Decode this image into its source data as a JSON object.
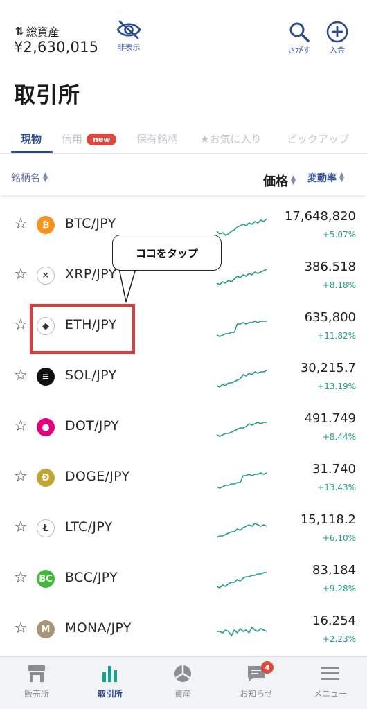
{
  "header": {
    "asset_icon": "swap-arrows-icon",
    "asset_label": "総資産",
    "asset_value": "¥2,630,015",
    "hide_label": "非表示",
    "search_label": "さがす",
    "deposit_label": "入金"
  },
  "page_title": "取引所",
  "tabs": [
    {
      "label": "現物",
      "active": true
    },
    {
      "label": "信用",
      "badge": "new"
    },
    {
      "label": "保有銘柄"
    },
    {
      "label": "★お気に入り"
    },
    {
      "label": "ピックアップ"
    }
  ],
  "sort": {
    "name": "銘柄名",
    "price": "価格",
    "change": "変動率"
  },
  "callout_text": "ココをタップ",
  "rows": [
    {
      "pair": "BTC/JPY",
      "price": "17,648,820",
      "change": "+5.07%",
      "color": "#f7931a",
      "glyph": "₿"
    },
    {
      "pair": "XRP/JPY",
      "price": "386.518",
      "change": "+8.18%",
      "color": "#ffffff",
      "glyph": "✕"
    },
    {
      "pair": "ETH/JPY",
      "price": "635,800",
      "change": "+11.82%",
      "color": "#ffffff",
      "glyph": "◆"
    },
    {
      "pair": "SOL/JPY",
      "price": "30,215.7",
      "change": "+13.19%",
      "color": "#111111",
      "glyph": "≡"
    },
    {
      "pair": "DOT/JPY",
      "price": "491.749",
      "change": "+8.44%",
      "color": "#e6007a",
      "glyph": "●"
    },
    {
      "pair": "DOGE/JPY",
      "price": "31.740",
      "change": "+13.43%",
      "color": "#c2a633",
      "glyph": "Ð"
    },
    {
      "pair": "LTC/JPY",
      "price": "15,118.2",
      "change": "+6.10%",
      "color": "#ffffff",
      "glyph": "Ł"
    },
    {
      "pair": "BCC/JPY",
      "price": "83,184",
      "change": "+9.28%",
      "color": "#43b83c",
      "glyph": "BC"
    },
    {
      "pair": "MONA/JPY",
      "price": "16.254",
      "change": "+2.23%",
      "color": "#a99475",
      "glyph": "M"
    }
  ],
  "bottom_nav": [
    {
      "label": "販売所",
      "icon": "store-icon"
    },
    {
      "label": "取引所",
      "icon": "bar-chart-icon",
      "active": true
    },
    {
      "label": "資産",
      "icon": "pie-chart-icon"
    },
    {
      "label": "お知らせ",
      "icon": "message-icon",
      "badge": "4"
    },
    {
      "label": "メニュー",
      "icon": "menu-icon"
    }
  ],
  "colors": {
    "accent_navy": "#2b4a8a",
    "positive_green": "#1f9e8a",
    "highlight_red": "#e23a3a",
    "badge_red": "#e0473d"
  }
}
